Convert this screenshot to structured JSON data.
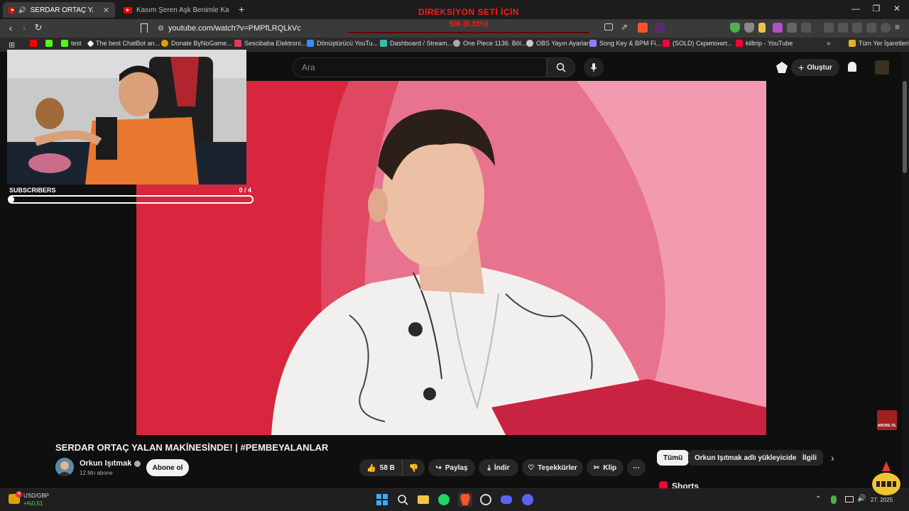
{
  "browser": {
    "tabs": [
      {
        "label": "SERDAR ORTAÇ YALAN MAKİ"
      },
      {
        "label": "Kasım Şeren Aşk Benimle Kamera Ark"
      }
    ],
    "new_tab": "+",
    "url": "youtube.com/watch?v=PMPfLRQLkVc",
    "bookmarks": [
      {
        "label": "test",
        "color": "#53fc18"
      },
      {
        "label": "The best ChatBot an...",
        "color": "#ffffff"
      },
      {
        "label": "Donate ByNoGame...",
        "color": "#e0a100"
      },
      {
        "label": "Sescibaba Elektroni...",
        "color": "#e33b5a"
      },
      {
        "label": "Dönüştürücü YouTu...",
        "color": "#3d8bfd"
      },
      {
        "label": "Dashboard / Stream...",
        "color": "#38bfa7"
      },
      {
        "label": "One Piece 1136. Böl...",
        "color": "#aaaaaa"
      },
      {
        "label": "OBS Yayın Ayarları",
        "color": "#cccccc"
      },
      {
        "label": "Song Key & BPM Fi...",
        "color": "#8a7dff"
      },
      {
        "label": "(SOLD) Скрипонит...",
        "color": "#ff0033"
      },
      {
        "label": "killtrip - YouTube",
        "color": "#ff0033"
      }
    ],
    "all_bookmarks": "Tüm Yer İşaretleri"
  },
  "overlay": {
    "donation_title": "DİREKSİYON SETİ İÇİN",
    "donation_value": "50€ (0.33%)",
    "subscribers_label": "SUBSCRIBERS",
    "subscribers_count": "0  / 4",
    "subscribers_progress": 0.02
  },
  "youtube": {
    "search_placeholder": "Ara",
    "create_label": "Oluştur",
    "video_title": "SERDAR ORTAÇ YALAN MAKİNESİNDE! | #PEMBEYALANLAR",
    "channel_name": "Orkun Işıtmak",
    "subscriber_count": "12 Mn abone",
    "subscribe_label": "Abone ol",
    "likes": "58 B",
    "share_label": "Paylaş",
    "download_label": "İndir",
    "thanks_label": "Teşekkürler",
    "clip_label": "Klip",
    "chips": [
      "Tümü",
      "Orkun Işıtmak adlı yükleyiciden",
      "İlgili"
    ],
    "shorts_label": "Shorts",
    "abone_badge": "ABONE OL"
  },
  "taskbar": {
    "ticker_pair": "USD/GBP",
    "ticker_change": "+%0,51",
    "notification_badge": "4",
    "clock": "27.  2025"
  },
  "colors": {
    "accent_red": "#ff1a1a",
    "yt_bg": "#0f0f0f",
    "video_pink": "#e56b86"
  }
}
